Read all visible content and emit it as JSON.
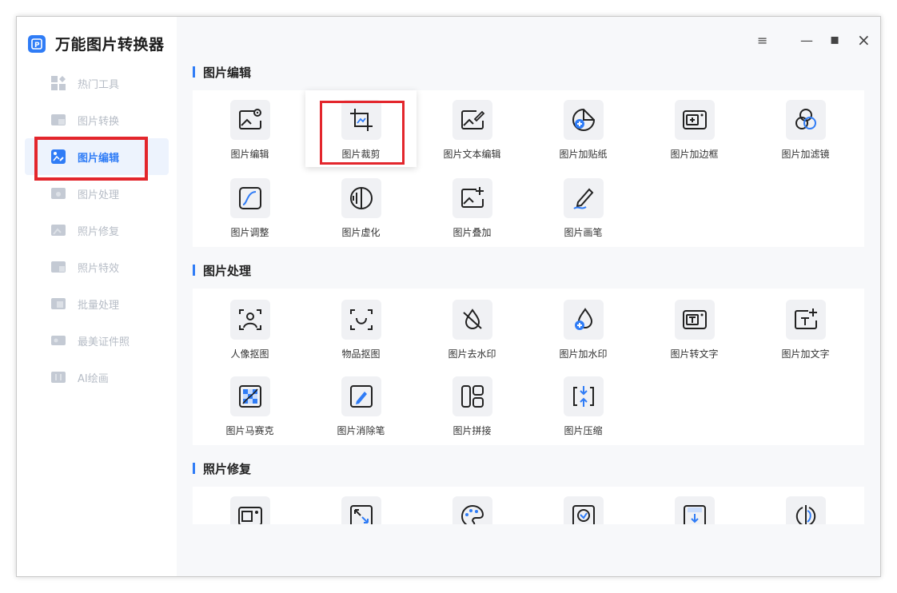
{
  "app": {
    "title": "万能图片转换器"
  },
  "window_controls": {
    "menu": "≡",
    "minimize": "—",
    "maximize": "▪",
    "close": "×"
  },
  "sidebar": {
    "items": [
      {
        "label": "热门工具",
        "icon": "grid-star-icon",
        "active": false
      },
      {
        "label": "图片转换",
        "icon": "image-convert-icon",
        "active": false
      },
      {
        "label": "图片编辑",
        "icon": "image-edit-icon",
        "active": true
      },
      {
        "label": "图片处理",
        "icon": "image-process-icon",
        "active": false
      },
      {
        "label": "照片修复",
        "icon": "photo-repair-icon",
        "active": false
      },
      {
        "label": "照片特效",
        "icon": "photo-effect-icon",
        "active": false
      },
      {
        "label": "批量处理",
        "icon": "batch-icon",
        "active": false
      },
      {
        "label": "最美证件照",
        "icon": "id-photo-icon",
        "active": false
      },
      {
        "label": "AI绘画",
        "icon": "ai-paint-icon",
        "active": false
      }
    ]
  },
  "sections": [
    {
      "title": "图片编辑",
      "tools": [
        {
          "label": "图片编辑",
          "icon": "image-settings-icon"
        },
        {
          "label": "图片裁剪",
          "icon": "crop-icon"
        },
        {
          "label": "图片文本编辑",
          "icon": "image-text-edit-icon"
        },
        {
          "label": "图片加贴纸",
          "icon": "sticker-icon"
        },
        {
          "label": "图片加边框",
          "icon": "frame-icon"
        },
        {
          "label": "图片加滤镜",
          "icon": "filter-icon"
        },
        {
          "label": "图片调整",
          "icon": "curve-adjust-icon"
        },
        {
          "label": "图片虚化",
          "icon": "blur-icon"
        },
        {
          "label": "图片叠加",
          "icon": "overlay-icon"
        },
        {
          "label": "图片画笔",
          "icon": "brush-icon"
        }
      ]
    },
    {
      "title": "图片处理",
      "tools": [
        {
          "label": "人像抠图",
          "icon": "portrait-cutout-icon"
        },
        {
          "label": "物品抠图",
          "icon": "object-cutout-icon"
        },
        {
          "label": "图片去水印",
          "icon": "remove-watermark-icon"
        },
        {
          "label": "图片加水印",
          "icon": "add-watermark-icon"
        },
        {
          "label": "图片转文字",
          "icon": "image-to-text-icon"
        },
        {
          "label": "图片加文字",
          "icon": "add-text-icon"
        },
        {
          "label": "图片马赛克",
          "icon": "mosaic-icon"
        },
        {
          "label": "图片消除笔",
          "icon": "eraser-pen-icon"
        },
        {
          "label": "图片拼接",
          "icon": "collage-icon"
        },
        {
          "label": "图片压缩",
          "icon": "compress-icon"
        }
      ]
    },
    {
      "title": "照片修复",
      "tools": [
        {
          "label": "",
          "icon": "photo-restore-icon"
        },
        {
          "label": "",
          "icon": "enlarge-icon"
        },
        {
          "label": "",
          "icon": "colorize-icon"
        },
        {
          "label": "",
          "icon": "face-repair-icon"
        },
        {
          "label": "",
          "icon": "download-frame-icon"
        },
        {
          "label": "",
          "icon": "sharpen-icon"
        }
      ]
    }
  ],
  "accent_color": "#2f7cf6",
  "highlight_color": "#e3262c"
}
